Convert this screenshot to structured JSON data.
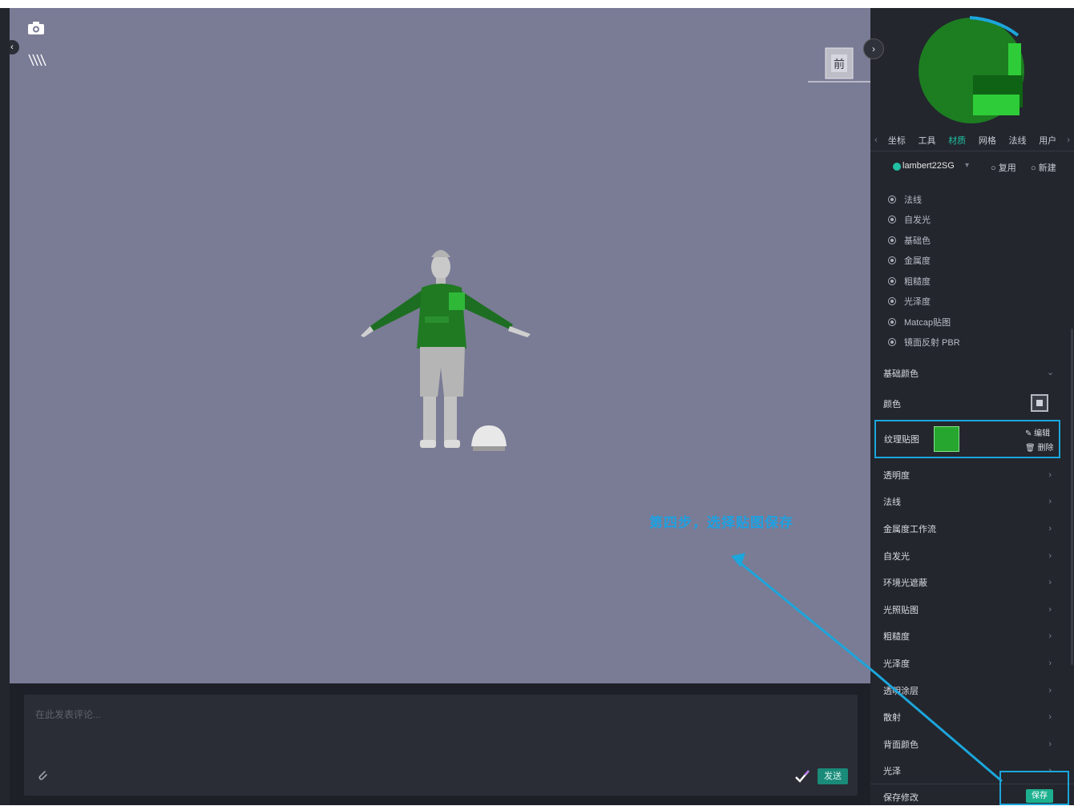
{
  "viewport": {
    "toolbar": {
      "camera_icon": "camera-icon",
      "hatch_icon": "hatch-icon"
    },
    "view_cube_label": "前"
  },
  "comment": {
    "placeholder": "在此发表评论...",
    "send_label": "发送"
  },
  "panel": {
    "tabs": [
      "坐标",
      "工具",
      "材质",
      "网格",
      "法线",
      "用户"
    ],
    "active_tab": "材质",
    "material": {
      "name": "lambert22SG",
      "action_1": "复用",
      "action_2": "新建"
    },
    "shaders": [
      "法线",
      "自发光",
      "基础色",
      "金属度",
      "粗糙度",
      "光泽度",
      "Matcap贴图",
      "镜面反射 PBR"
    ],
    "section_title": "基础颜色",
    "color_label": "颜色",
    "texture": {
      "label": "纹理贴图",
      "edit": "编辑",
      "delete": "删除"
    },
    "properties": [
      "透明度",
      "法线",
      "金属度工作流",
      "自发光",
      "环境光遮蔽",
      "光照贴图",
      "粗糙度",
      "光泽度",
      "透明涂层",
      "散射",
      "背面颜色",
      "光泽"
    ],
    "save_label": "保存修改",
    "save_button": "保存"
  },
  "annotation": {
    "text": "第四步，选择贴图保存"
  },
  "colors": {
    "viewport_bg": "#7a7b95",
    "panel_bg": "#23262d",
    "accent": "#21c1a3",
    "annotation": "#1ca6dc",
    "hoodie": "#1f7a22"
  }
}
